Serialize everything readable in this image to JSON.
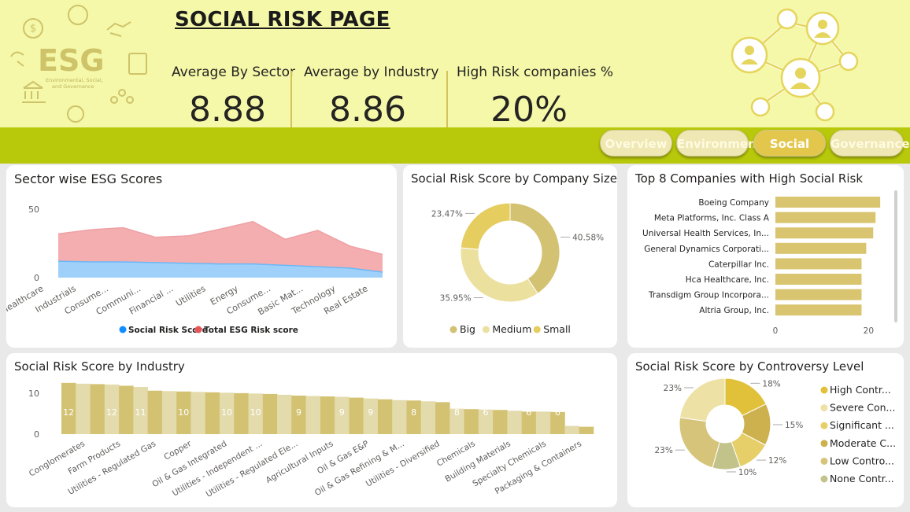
{
  "header": {
    "logo_text": "ESG",
    "logo_subtext": "Environmental, Social, and Governance",
    "title": "SOCIAL RISK PAGE",
    "kpis": [
      {
        "label": "Average By Sector",
        "value": "8.88"
      },
      {
        "label": "Average by Industry",
        "value": "8.86"
      },
      {
        "label": "High Risk companies %",
        "value": "20%"
      }
    ]
  },
  "nav": {
    "buttons": [
      {
        "label": "Overview",
        "active": false
      },
      {
        "label": "Environment",
        "active": false
      },
      {
        "label": "Social",
        "active": true
      },
      {
        "label": "Governance",
        "active": false
      }
    ]
  },
  "colors": {
    "accent_yellow": "#f4f8a8",
    "nav_green": "#b8c80a",
    "social_blue": "#118dff",
    "total_red": "#e8545a",
    "gold": "#d9c46f"
  },
  "chart_data": [
    {
      "id": "sector",
      "type": "area",
      "title": "Sector wise ESG Scores",
      "categories": [
        "Healthcare",
        "Industrials",
        "Consume...",
        "Communi...",
        "Financial ...",
        "Utilities",
        "Energy",
        "Consume...",
        "Basic Mat...",
        "Technology",
        "Real Estate"
      ],
      "series": [
        {
          "name": "Social Risk Score",
          "color": "#118dff",
          "values": [
            12,
            11.5,
            11.5,
            11,
            10.5,
            10,
            10,
            9,
            8,
            7,
            4
          ]
        },
        {
          "name": "Total ESG Risk score",
          "color": "#e8545a",
          "values": [
            32,
            35,
            36.5,
            29.5,
            30.5,
            35.5,
            41,
            28,
            34.5,
            23,
            17
          ]
        }
      ],
      "yticks": [
        "0",
        "50"
      ],
      "ylim": [
        0,
        50
      ],
      "legend": "bottom"
    },
    {
      "id": "size",
      "type": "pie",
      "title": "Social Risk Score by Company Size",
      "slices": [
        {
          "name": "Big",
          "value": 40.58,
          "label": "40.58%",
          "color": "#d4c273"
        },
        {
          "name": "Medium",
          "value": 35.95,
          "label": "35.95%",
          "color": "#ece09f"
        },
        {
          "name": "Small",
          "value": 23.47,
          "label": "23.47%",
          "color": "#e6cd5f"
        }
      ],
      "legend": "bottom"
    },
    {
      "id": "top8",
      "type": "bar",
      "title": "Top 8 Companies with High Social Risk",
      "categories": [
        "Boeing Company",
        "Meta Platforms, Inc. Class A",
        "Universal Health Services, In...",
        "General Dynamics Corporati...",
        "Caterpillar Inc.",
        "Hca Healthcare, Inc.",
        "Transdigm Group Incorpora...",
        "Altria Group, Inc."
      ],
      "values": [
        22.5,
        21.5,
        21,
        19.5,
        18.5,
        18.5,
        18.5,
        18.5
      ],
      "xticks": [
        "0",
        "20"
      ],
      "xlim": [
        0,
        24
      ],
      "color": "#d9c46f"
    },
    {
      "id": "industry",
      "type": "bar",
      "title": "Social Risk Score by Industry",
      "yticks": [
        "0",
        "10"
      ],
      "ylim": [
        0,
        14
      ],
      "values": [
        12.5,
        12.3,
        12.2,
        12.1,
        11.8,
        11.5,
        10.6,
        10.5,
        10.4,
        10.3,
        10.2,
        10.1,
        10.0,
        9.9,
        9.8,
        9.6,
        9.4,
        9.3,
        9.2,
        9.1,
        8.9,
        8.7,
        8.5,
        8.3,
        8.2,
        8.0,
        7.8,
        6.2,
        6.1,
        6.0,
        5.9,
        5.7,
        5.5,
        5.5,
        5.4,
        2.0,
        1.8
      ],
      "value_labels": [
        "12",
        "12",
        "11",
        "10",
        "10",
        "10",
        "9",
        "9",
        "9",
        "8",
        "8",
        "6",
        "6",
        "6"
      ],
      "axis_labels": [
        "Conglomerates",
        "Farm Products",
        "Utilities - Regulated Gas",
        "Copper",
        "Oil & Gas Integrated",
        "Utilities - Independent ...",
        "Utilities - Regulated Ele...",
        "Agricultural Inputs",
        "Oil & Gas E&P",
        "Oil & Gas Refining & M...",
        "Utilities - Diversified",
        "Chemicals",
        "Building Materials",
        "Specialty Chemicals",
        "Packaging & Containers"
      ],
      "colors": [
        "#d4c273",
        "#e3dbab"
      ]
    },
    {
      "id": "controversy",
      "type": "pie",
      "title": "Social Risk Score by Controversy Level",
      "slices": [
        {
          "name": "High Contr...",
          "value": 18,
          "label": "18%",
          "color": "#e2c13a"
        },
        {
          "name": "Moderate C...",
          "value": 15,
          "label": "15%",
          "color": "#cdb14f"
        },
        {
          "name": "Significant ...",
          "value": 12,
          "label": "12%",
          "color": "#e6cf68"
        },
        {
          "name": "None Contr...",
          "value": 10,
          "label": "10%",
          "color": "#c2c38a"
        },
        {
          "name": "Low Contro...",
          "value": 23,
          "label": "23%",
          "color": "#d6c47a"
        },
        {
          "name": "Severe Con...",
          "value": 23,
          "label": "23%",
          "color": "#ede1a6"
        }
      ],
      "legend_order": [
        "High Contr...",
        "Severe Con...",
        "Significant ...",
        "Moderate C...",
        "Low Contro...",
        "None Contr..."
      ],
      "legend": "right"
    }
  ]
}
